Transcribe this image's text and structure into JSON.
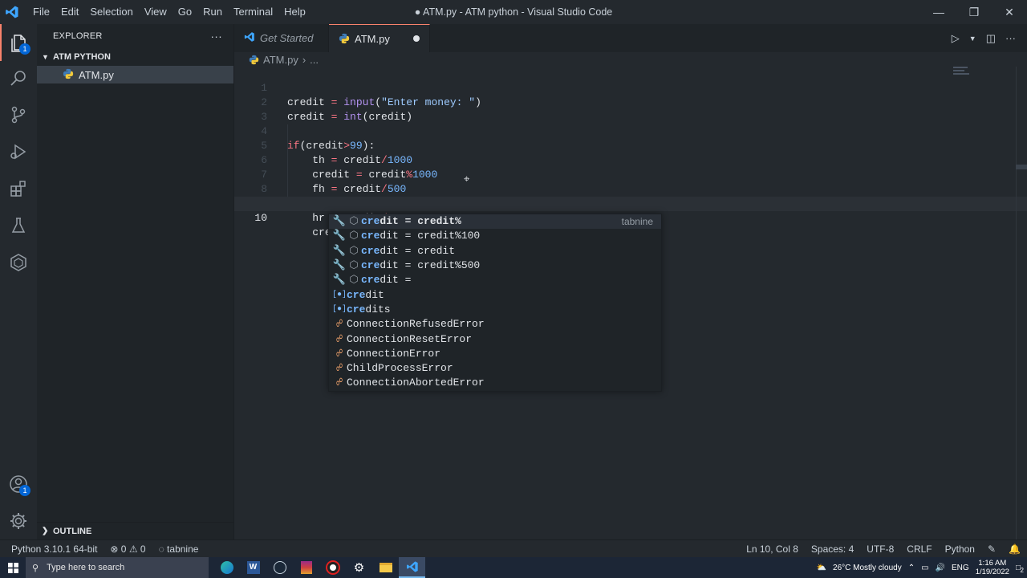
{
  "window": {
    "title": "● ATM.py - ATM python - Visual Studio Code",
    "menu": [
      "File",
      "Edit",
      "Selection",
      "View",
      "Go",
      "Run",
      "Terminal",
      "Help"
    ]
  },
  "activity_bar": {
    "explorer_badge": "1",
    "accounts_badge": "1"
  },
  "sidebar": {
    "header": "EXPLORER",
    "more": "···",
    "folder": "ATM PYTHON",
    "file": "ATM.py",
    "outline": "OUTLINE"
  },
  "tabs": [
    {
      "label": "Get Started"
    },
    {
      "label": "ATM.py"
    }
  ],
  "breadcrumb": {
    "file": "ATM.py",
    "sep": "›",
    "rest": "..."
  },
  "editor": {
    "line_numbers": [
      "1",
      "2",
      "3",
      "4",
      "5",
      "6",
      "7",
      "8",
      "9",
      "10"
    ],
    "typed": "cre"
  },
  "suggestions": [
    {
      "match": "cre",
      "rest": "dit = credit%",
      "detail": "tabnine",
      "kind": "tabnine"
    },
    {
      "match": "cre",
      "rest": "dit = credit%100",
      "kind": "tabnine"
    },
    {
      "match": "cre",
      "rest": "dit = credit",
      "kind": "tabnine"
    },
    {
      "match": "cre",
      "rest": "dit = credit%500",
      "kind": "tabnine"
    },
    {
      "match": "cre",
      "rest": "dit =",
      "kind": "tabnine"
    },
    {
      "match": "cre",
      "rest": "dit",
      "kind": "variable"
    },
    {
      "match": "cre",
      "rest": "dits",
      "kind": "variable"
    },
    {
      "match": "ConnectionRe",
      "rest": "fusedError",
      "kind": "class"
    },
    {
      "match": "ConnectionRe",
      "rest": "setError",
      "kind": "class"
    },
    {
      "match": "Connection",
      "rest": "Error",
      "kind": "class"
    },
    {
      "match": "ChildProcess",
      "rest": "Error",
      "kind": "class"
    },
    {
      "match": "ConnectionAborted",
      "rest": "Error",
      "kind": "class"
    }
  ],
  "statusbar": {
    "python": "Python 3.10.1 64-bit",
    "errors": "⊗ 0 ⚠ 0",
    "tabnine": "◌ tabnine",
    "position": "Ln 10, Col 8",
    "spaces": "Spaces: 4",
    "encoding": "UTF-8",
    "eol": "CRLF",
    "language": "Python"
  },
  "taskbar": {
    "search_placeholder": "Type here to search",
    "weather": "26°C  Mostly cloudy",
    "lang": "ENG",
    "time": "1:16 AM",
    "date": "1/19/2022",
    "notifications": "2"
  },
  "colors": {
    "accent": "#f9826c",
    "keyword": "#f97583",
    "function": "#b392f0",
    "string": "#9ecbff",
    "number": "#79b8ff"
  }
}
